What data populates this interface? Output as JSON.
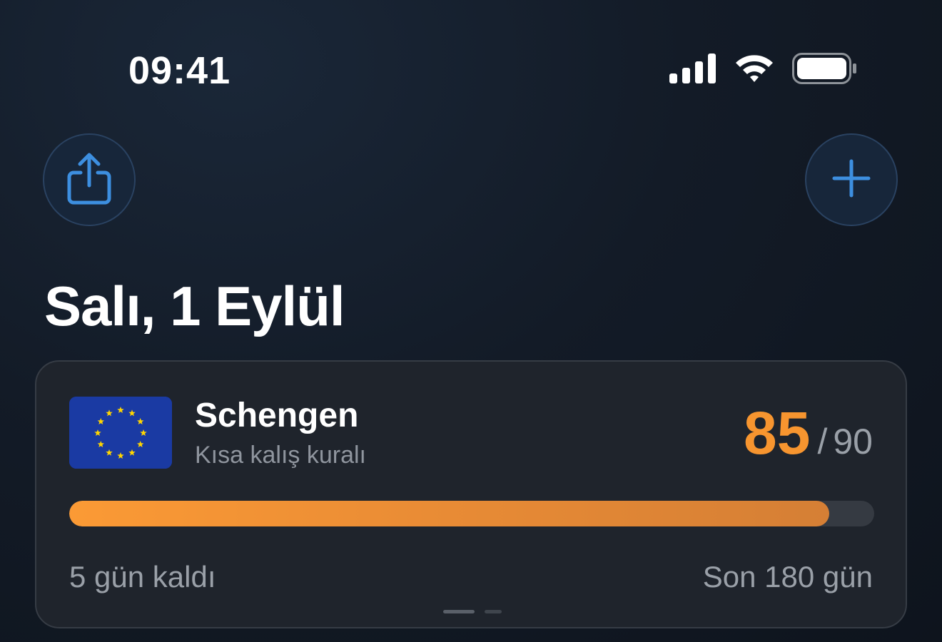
{
  "status_bar": {
    "time": "09:41",
    "icons": [
      "cellular-signal-icon",
      "wifi-icon",
      "battery-icon"
    ]
  },
  "header": {
    "share_icon": "share-icon",
    "add_icon": "plus-icon",
    "title": "Salı, 1 Eylül"
  },
  "card": {
    "flag_icon": "eu-flag-icon",
    "zone_name": "Schengen",
    "rule": "Kısa kalış kuralı",
    "days_used": "85",
    "separator": "/",
    "days_limit": "90",
    "progress_fraction": 0.944,
    "remaining_text": "5 gün kaldı",
    "window_text": "Son 180 gün",
    "page_indicator": {
      "count": 2,
      "active_index": 0
    }
  },
  "colors": {
    "accent_orange": "#f7952f",
    "accent_blue": "#3d8fe0",
    "background": "#131b27",
    "card": "#1f242c",
    "eu_blue": "#1a3aa3",
    "eu_star": "#ffd500"
  }
}
